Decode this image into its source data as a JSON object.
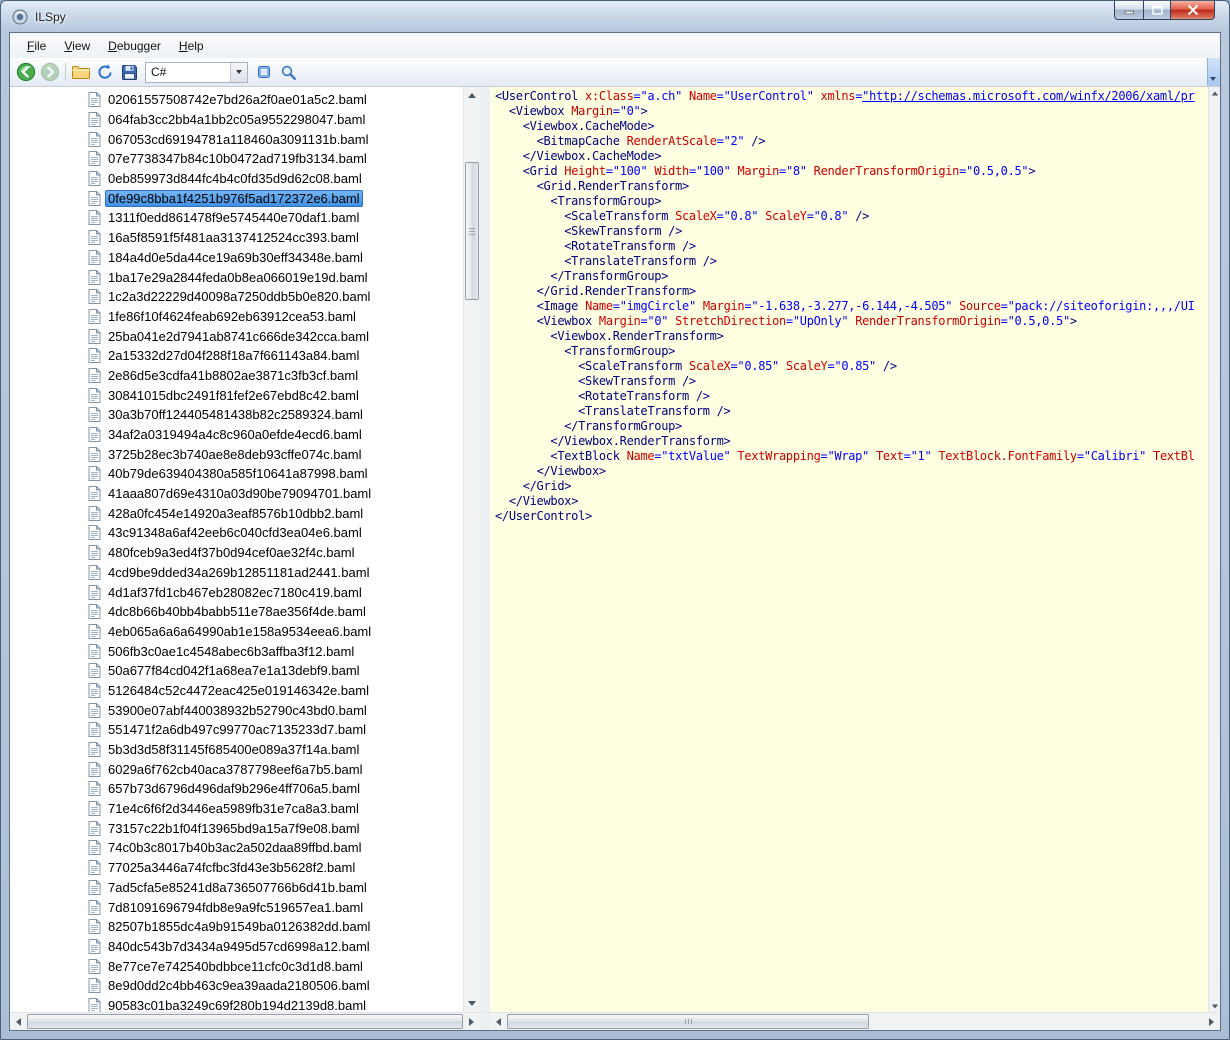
{
  "window": {
    "title": "ILSpy"
  },
  "menu": {
    "items": [
      {
        "label": "File",
        "accel": "F"
      },
      {
        "label": "View",
        "accel": "V"
      },
      {
        "label": "Debugger",
        "accel": "D"
      },
      {
        "label": "Help",
        "accel": "H"
      }
    ]
  },
  "toolbar": {
    "language": "C#"
  },
  "icons": {
    "app": "ilspy-app-icon",
    "minimize": "minimize-icon",
    "maximize": "maximize-icon",
    "close": "close-icon",
    "back": "back-arrow-icon",
    "forward": "forward-arrow-icon",
    "open": "open-folder-icon",
    "refresh": "refresh-icon",
    "save": "save-floppy-icon",
    "misc": "tool-icon",
    "search": "search-icon",
    "tree_item": "baml-document-icon"
  },
  "colors": {
    "selection": "#4190E2",
    "code-background": "#FFFFE1",
    "xml-tag": "#000080",
    "xml-attribute": "#CC0000",
    "xml-value": "#0000FF"
  },
  "tree": {
    "selected_index": 5,
    "items": [
      "02061557508742e7bd26a2f0ae01a5c2.baml",
      "064fab3cc2bb4a1bb2c05a9552298047.baml",
      "067053cd69194781a118460a3091131b.baml",
      "07e7738347b84c10b0472ad719fb3134.baml",
      "0eb859973d844fc4b4c0fd35d9d62c08.baml",
      "0fe99c8bba1f4251b976f5ad172372e6.baml",
      "1311f0edd861478f9e5745440e70daf1.baml",
      "16a5f8591f5f481aa3137412524cc393.baml",
      "184a4d0e5da44ce19a69b30eff34348e.baml",
      "1ba17e29a2844feda0b8ea066019e19d.baml",
      "1c2a3d22229d40098a7250ddb5b0e820.baml",
      "1fe86f10f4624feab692eb63912cea53.baml",
      "25ba041e2d7941ab8741c666de342cca.baml",
      "2a15332d27d04f288f18a7f661143a84.baml",
      "2e86d5e3cdfa41b8802ae3871c3fb3cf.baml",
      "30841015dbc2491f81fef2e67ebd8c42.baml",
      "30a3b70ff124405481438b82c2589324.baml",
      "34af2a0319494a4c8c960a0efde4ecd6.baml",
      "3725b28ec3b740ae8e8deb93cffe074c.baml",
      "40b79de639404380a585f10641a87998.baml",
      "41aaa807d69e4310a03d90be79094701.baml",
      "428a0fc454e14920a3eaf8576b10dbb2.baml",
      "43c91348a6af42eeb6c040cfd3ea04e6.baml",
      "480fceb9a3ed4f37b0d94cef0ae32f4c.baml",
      "4cd9be9dded34a269b12851181ad2441.baml",
      "4d1af37fd1cb467eb28082ec7180c419.baml",
      "4dc8b66b40bb4babb511e78ae356f4de.baml",
      "4eb065a6a6a64990ab1e158a9534eea6.baml",
      "506fb3c0ae1c4548abec6b3affba3f12.baml",
      "50a677f84cd042f1a68ea7e1a13debf9.baml",
      "5126484c52c4472eac425e019146342e.baml",
      "53900e07abf440038932b52790c43bd0.baml",
      "551471f2a6db497c99770ac7135233d7.baml",
      "5b3d3d58f31145f685400e089a37f14a.baml",
      "6029a6f762cb40aca3787798eef6a7b5.baml",
      "657b73d6796d496daf9b296e4ff706a5.baml",
      "71e4c6f6f2d3446ea5989fb31e7ca8a3.baml",
      "73157c22b1f04f13965bd9a15a7f9e08.baml",
      "74c0b3c8017b40b3ac2a502daa89ffbd.baml",
      "77025a3446a74fcfbc3fd43e3b5628f2.baml",
      "7ad5cfa5e85241d8a736507766b6d41b.baml",
      "7d81091696794fdb8e9a9fc519657ea1.baml",
      "82507b1855dc4a9b91549ba0126382dd.baml",
      "840dc543b7d3434a9495d57cd6998a12.baml",
      "8e77ce7e742540bdbbce11cfc0c3d1d8.baml",
      "8e9d0dd2c4bb463c9ea39aada2180506.baml",
      "90583c01ba3249c69f280b194d2139d8.baml"
    ]
  },
  "code_view": {
    "lines": [
      "<UserControl x:Class=\"a.ch\" Name=\"UserControl\" xmlns=\"http://schemas.microsoft.com/winfx/2006/xaml/pr",
      "  <Viewbox Margin=\"0\">",
      "    <Viewbox.CacheMode>",
      "      <BitmapCache RenderAtScale=\"2\" />",
      "    </Viewbox.CacheMode>",
      "    <Grid Height=\"100\" Width=\"100\" Margin=\"8\" RenderTransformOrigin=\"0.5,0.5\">",
      "      <Grid.RenderTransform>",
      "        <TransformGroup>",
      "          <ScaleTransform ScaleX=\"0.8\" ScaleY=\"0.8\" />",
      "          <SkewTransform />",
      "          <RotateTransform />",
      "          <TranslateTransform />",
      "        </TransformGroup>",
      "      </Grid.RenderTransform>",
      "      <Image Name=\"imgCircle\" Margin=\"-1.638,-3.277,-6.144,-4.505\" Source=\"pack://siteoforigin:,,,/UI",
      "      <Viewbox Margin=\"0\" StretchDirection=\"UpOnly\" RenderTransformOrigin=\"0.5,0.5\">",
      "        <Viewbox.RenderTransform>",
      "          <TransformGroup>",
      "            <ScaleTransform ScaleX=\"0.85\" ScaleY=\"0.85\" />",
      "            <SkewTransform />",
      "            <RotateTransform />",
      "            <TranslateTransform />",
      "          </TransformGroup>",
      "        </Viewbox.RenderTransform>",
      "        <TextBlock Name=\"txtValue\" TextWrapping=\"Wrap\" Text=\"1\" TextBlock.FontFamily=\"Calibri\" TextBl",
      "      </Viewbox>",
      "    </Grid>",
      "  </Viewbox>",
      "</UserControl>"
    ]
  }
}
